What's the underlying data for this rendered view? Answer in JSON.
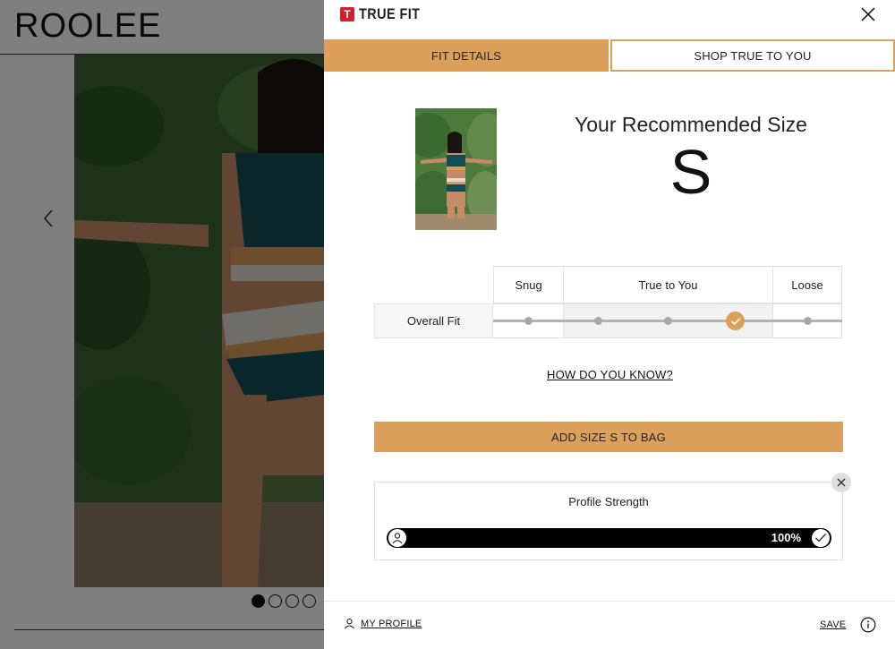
{
  "store": {
    "brand": "ROOLEE",
    "carousel": {
      "slide_count": 4,
      "active_index": 0
    }
  },
  "modal": {
    "logo_text": "TRUE FIT",
    "logo_badge": "T",
    "tabs": [
      {
        "label": "FIT DETAILS",
        "active": true
      },
      {
        "label": "SHOP TRUE TO YOU",
        "active": false
      }
    ],
    "recommendation": {
      "title": "Your Recommended Size",
      "size": "S"
    },
    "fit_table": {
      "columns": [
        "Snug",
        "True to You",
        "Loose"
      ],
      "row_label": "Overall Fit",
      "selected_point": 4,
      "point_count": 5
    },
    "how_link": "HOW DO YOU KNOW?",
    "add_button": "ADD SIZE S TO BAG",
    "profile": {
      "title": "Profile Strength",
      "strength_percent": "100%",
      "strength_value": 1.0
    },
    "footer": {
      "my_profile": "MY PROFILE",
      "save": "SAVE"
    }
  },
  "colors": {
    "accent": "#dca05a",
    "logo_red": "#d3202f",
    "overlay": "rgba(0,0,0,0.5)"
  }
}
